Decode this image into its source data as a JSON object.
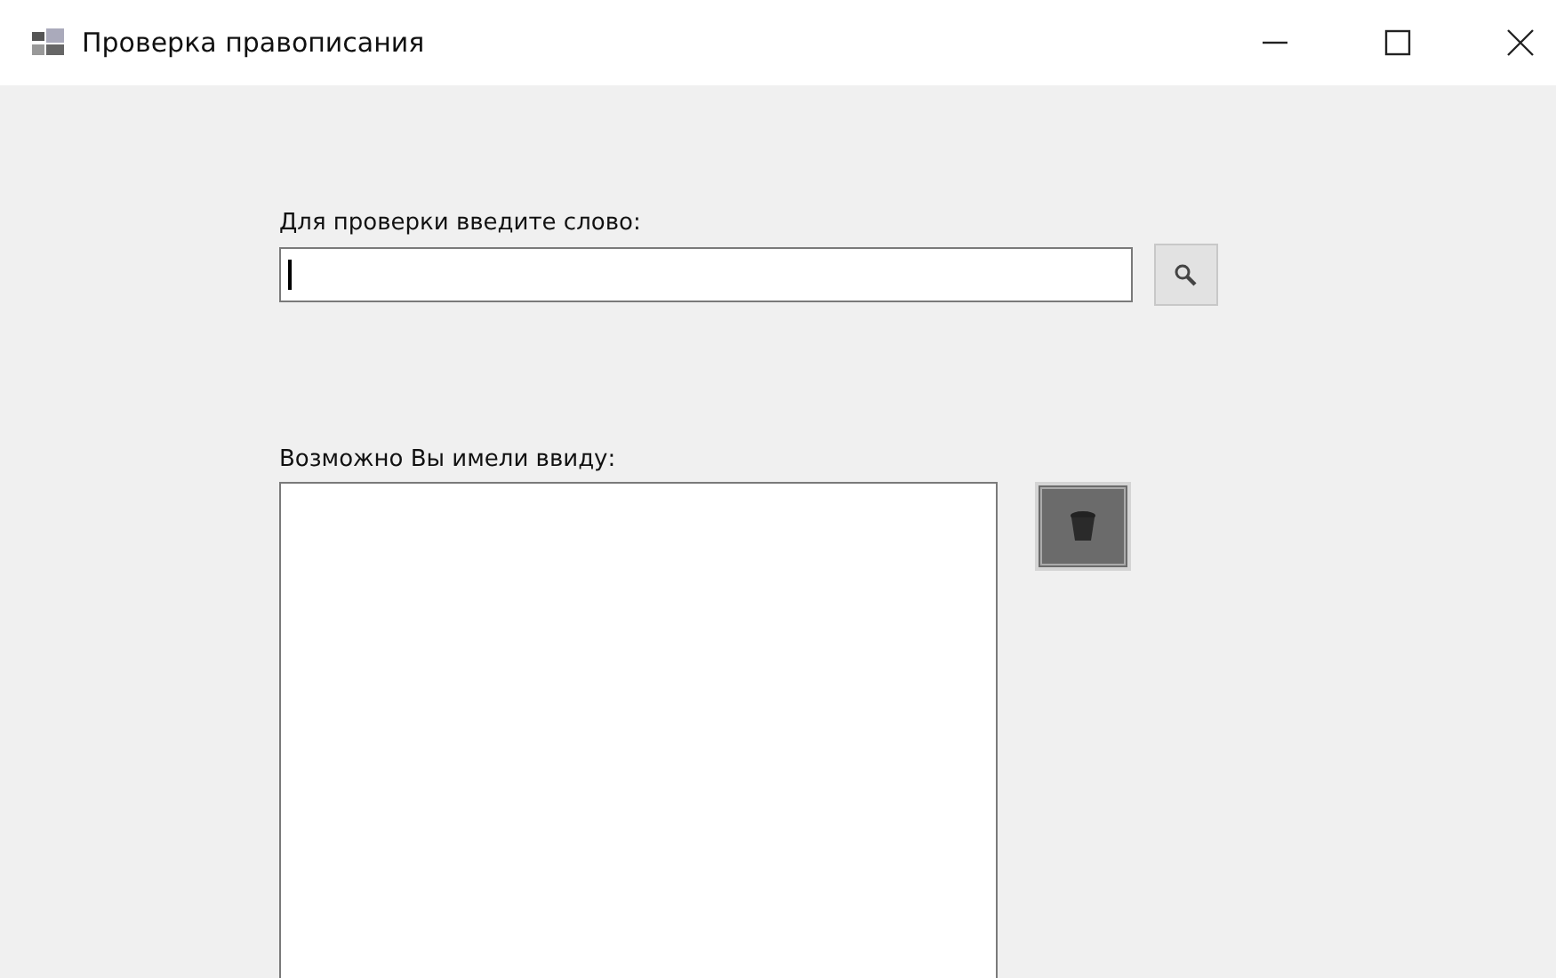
{
  "window": {
    "title": "Проверка правописания"
  },
  "word_input": {
    "label": "Для проверки введите слово:",
    "focused": true
  },
  "suggestions": {
    "label": "Возможно Вы имели ввиду:"
  }
}
